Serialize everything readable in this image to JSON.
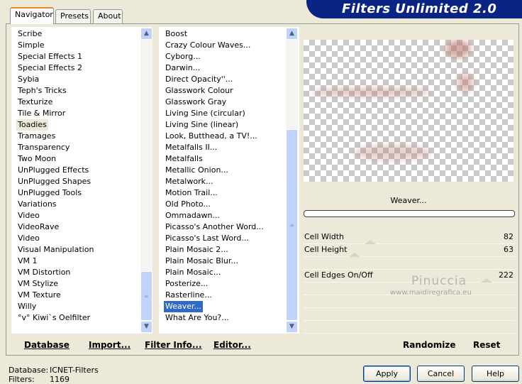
{
  "window": {
    "title": "Filters Unlimited 2.0"
  },
  "tabs": [
    "Navigator",
    "Presets",
    "About"
  ],
  "categories": [
    "Scribe",
    "Simple",
    "Special Effects 1",
    "Special Effects 2",
    "Sybia",
    "Teph's Tricks",
    "Texturize",
    "Tile & Mirror",
    "Toadies",
    "Tramages",
    "Transparency",
    "Two Moon",
    "UnPlugged Effects",
    "UnPlugged Shapes",
    "UnPlugged Tools",
    "Variations",
    "Video",
    "VideoRave",
    "Video",
    "Visual Manipulation",
    "VM 1",
    "VM Distortion",
    "VM Stylize",
    "VM Texture",
    "Willy",
    "°v° Kiwi`s Oelfilter"
  ],
  "selected_category": "Toadies",
  "filters": [
    "Boost",
    "Crazy Colour Waves...",
    "Cyborg...",
    "Darwin...",
    "Direct Opacity''...",
    "Glasswork Colour",
    "Glasswork Gray",
    "Living Sine (circular)",
    "Living Sine (linear)",
    "Look, Butthead, a TV!...",
    "Metalfalls II...",
    "Metalfalls",
    "Metallic Onion...",
    "Metalwork...",
    "Motion Trail...",
    "Old Photo...",
    "Ommadawn...",
    "Picasso's Another Word...",
    "Picasso's Last Word...",
    "Plain Mosaic 2...",
    "Plain Mosaic Blur...",
    "Plain Mosaic...",
    "Posterize...",
    "Rasterline...",
    "Weaver...",
    "What Are You?..."
  ],
  "selected_filter": "Weaver...",
  "preview": {
    "filter_name": "Weaver..."
  },
  "params": [
    {
      "label": "Cell Width",
      "value": "82"
    },
    {
      "label": "Cell Height",
      "value": "63"
    },
    {
      "label": "Cell Edges On/Off",
      "value": "222"
    }
  ],
  "watermark": {
    "line1": "Pinuccia",
    "line2": "www.maidiregrafica.eu"
  },
  "left_actions": {
    "database": "Database",
    "import": "Import...",
    "filter_info": "Filter Info...",
    "editor": "Editor..."
  },
  "right_actions": {
    "randomize": "Randomize",
    "reset": "Reset"
  },
  "status": {
    "database_label": "Database:",
    "database_value": "ICNET-Filters",
    "filters_label": "Filters:",
    "filters_value": "1169"
  },
  "buttons": {
    "apply": "Apply",
    "cancel": "Cancel",
    "help": "Help"
  },
  "colors": {
    "banner": "#0a2484",
    "selection": "#316ac5",
    "scroll": "#c1d3fb"
  },
  "icons": {
    "scroll_up": "▲",
    "scroll_down": "▼",
    "thumb_grip": "≡"
  }
}
